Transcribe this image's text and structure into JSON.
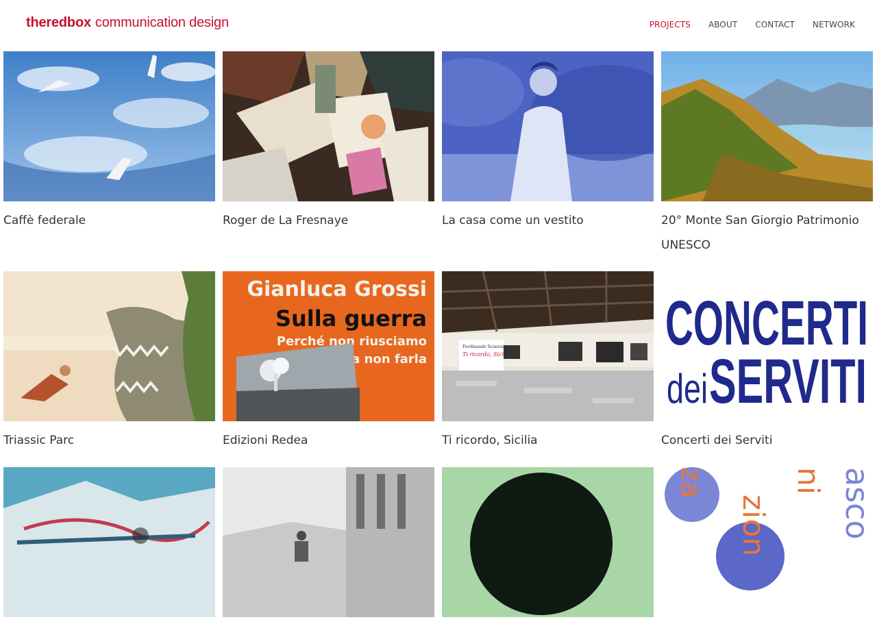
{
  "header": {
    "brand": "theredbox",
    "tagline": "communication design",
    "nav": [
      {
        "label": "PROJECTS",
        "active": true
      },
      {
        "label": "ABOUT",
        "active": false
      },
      {
        "label": "CONTACT",
        "active": false
      },
      {
        "label": "NETWORK",
        "active": false
      }
    ]
  },
  "projects": [
    {
      "title": "Caffè federale"
    },
    {
      "title": "Roger de La Fresnaye"
    },
    {
      "title": "La casa come un vestito"
    },
    {
      "title": "20° Monte San Giorgio Patrimonio UNESCO"
    },
    {
      "title": "Triassic Parc"
    },
    {
      "title": "Edizioni Redea",
      "cover": {
        "author": "Gianluca Grossi",
        "title": "Sulla guerra",
        "subtitle_1": "Perché non riusciamo",
        "subtitle_2": "a non farla"
      }
    },
    {
      "title": "Ti ricordo, Sicilia",
      "sign": {
        "line1": "Ferdinando Scianna",
        "line2": "Ti ricordo, Sicilia"
      }
    },
    {
      "title": "Concerti dei Serviti",
      "poster": {
        "line1": "CONCERTI",
        "line2a": "dei",
        "line2b": "SERVITI"
      }
    },
    {
      "title": ""
    },
    {
      "title": ""
    },
    {
      "title": ""
    },
    {
      "title": "",
      "poster_text": {
        "a": "ni",
        "b": "zion",
        "c": "asco",
        "d": "za"
      }
    }
  ],
  "colors": {
    "brand": "#c8102e",
    "text": "#333333",
    "nav": "#444444"
  }
}
